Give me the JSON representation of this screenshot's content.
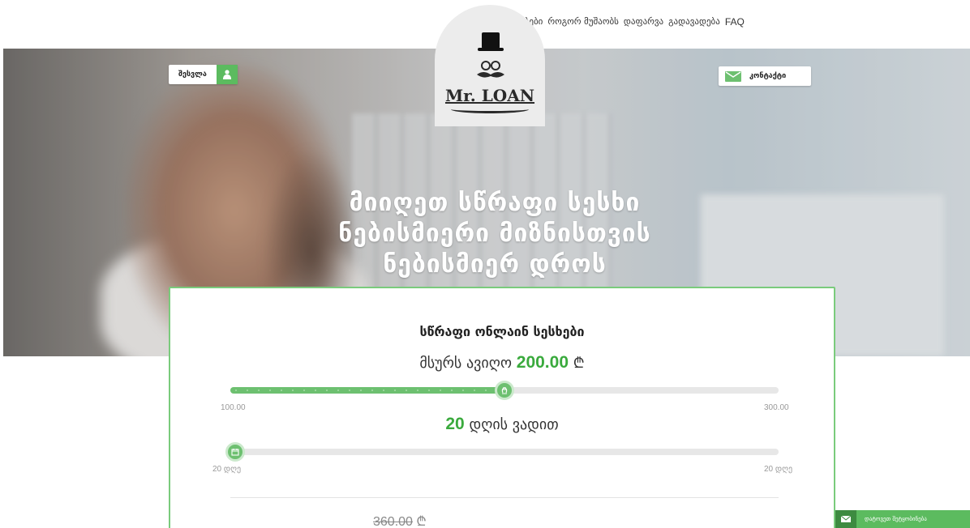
{
  "nav": {
    "items": [
      "პირობები",
      "როგორ მუშაობს",
      "დაფარვა",
      "გადავადება",
      "FAQ"
    ]
  },
  "logo": {
    "text": "Mr. LOAN"
  },
  "auth": {
    "login_label": "შესვლა"
  },
  "contact": {
    "label": "კონტაქტი"
  },
  "hero": {
    "headline_line1": "მიიღეთ სწრაფი სესხი",
    "headline_line2": "ნებისმიერი მიზნისთვის",
    "headline_line3": "ნებისმიერ დროს"
  },
  "calculator": {
    "title": "სწრაფი ონლაინ სესხები",
    "amount_prefix": "მსურს ავიღო",
    "amount_value": "200.00",
    "currency": "₾",
    "amount_min": "100.00",
    "amount_max": "300.00",
    "amount_fraction": 0.5,
    "days_value": "20",
    "days_suffix": "დღის ვადით",
    "days_min": "20 დღე",
    "days_max": "20 დღე",
    "days_fraction": 0.0,
    "total_value": "360.00"
  },
  "feedback": {
    "label": "დატოვეთ შეტყობინება"
  },
  "colors": {
    "accent": "#5cbb5f",
    "accent_dark": "#3aaa3d",
    "card_border": "#7acb7c"
  }
}
